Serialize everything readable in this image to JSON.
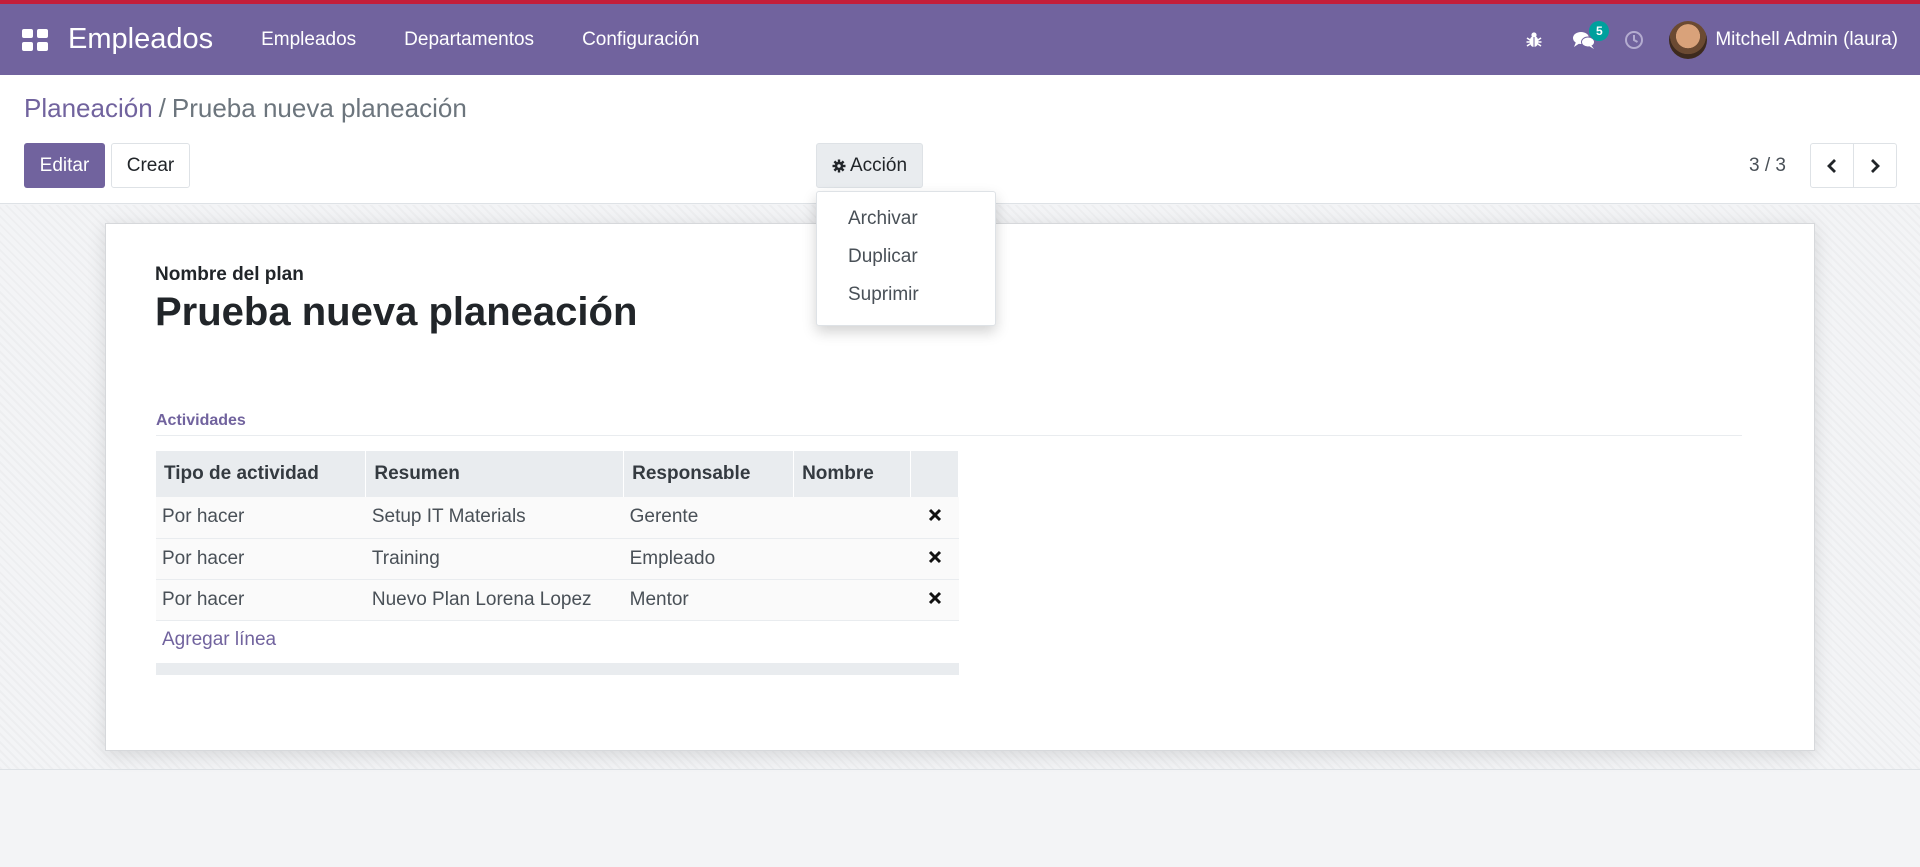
{
  "navbar": {
    "app_name": "Empleados",
    "menu": [
      "Empleados",
      "Departamentos",
      "Configuración"
    ],
    "messages_count": "5",
    "user_name": "Mitchell Admin (laura)",
    "color": "#71639e"
  },
  "breadcrumb": {
    "parent": "Planeación",
    "separator": "/",
    "current": "Prueba nueva planeación"
  },
  "toolbar": {
    "edit_label": "Editar",
    "create_label": "Crear",
    "action_label": "Acción",
    "pager": "3 / 3"
  },
  "action_menu": {
    "items": [
      "Archivar",
      "Duplicar",
      "Suprimir"
    ]
  },
  "form": {
    "name_label": "Nombre del plan",
    "name_value": "Prueba nueva planeación",
    "section_title": "Actividades",
    "columns": [
      "Tipo de actividad",
      "Resumen",
      "Responsable",
      "Nombre"
    ],
    "rows": [
      {
        "type": "Por hacer",
        "summary": "Setup IT Materials",
        "responsible": "Gerente",
        "name": ""
      },
      {
        "type": "Por hacer",
        "summary": "Training",
        "responsible": "Empleado",
        "name": ""
      },
      {
        "type": "Por hacer",
        "summary": "Nuevo Plan Lorena Lopez",
        "responsible": "Mentor",
        "name": ""
      }
    ],
    "add_line_label": "Agregar línea"
  }
}
